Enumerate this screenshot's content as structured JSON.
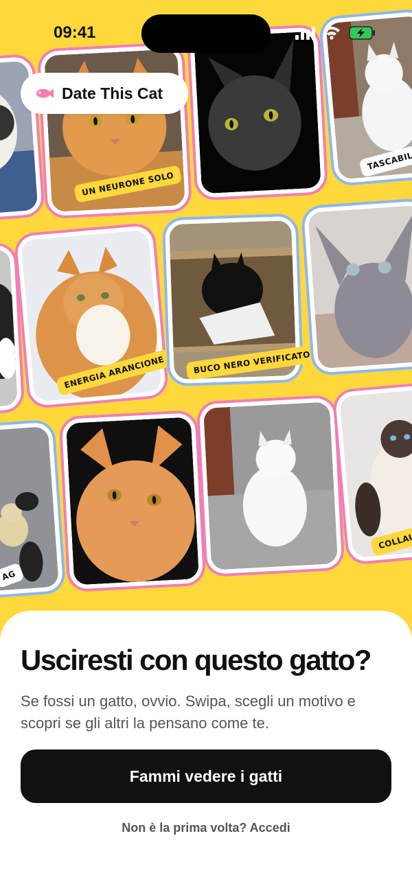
{
  "status_bar": {
    "time": "09:41"
  },
  "brand": {
    "name": "Date This Cat",
    "icon": "fish-icon"
  },
  "cards": [
    {
      "id": "c1",
      "tag": "",
      "photo": "calico-cat"
    },
    {
      "id": "c2",
      "tag": "UN NEURONE SOLO",
      "photo": "orange-tabby-cat"
    },
    {
      "id": "c3",
      "tag": "",
      "photo": "grey-cat"
    },
    {
      "id": "c4",
      "tag": "TASCABILE",
      "photo": "white-cat-small"
    },
    {
      "id": "c5",
      "tag": "",
      "photo": "tuxedo-cat"
    },
    {
      "id": "c6",
      "tag": "ENERGIA ARANCIONE",
      "photo": "fluffy-orange-cat"
    },
    {
      "id": "c7",
      "tag": "BUCO NERO VERIFICATO",
      "photo": "black-kitten-in-box"
    },
    {
      "id": "c8",
      "tag": "",
      "photo": "sphynx-cat"
    },
    {
      "id": "c9",
      "tag": "AG",
      "photo": "teddy-bear"
    },
    {
      "id": "c10",
      "tag": "",
      "photo": "orange-cat-closeup"
    },
    {
      "id": "c11",
      "tag": "",
      "photo": "white-cat-sitting"
    },
    {
      "id": "c12",
      "tag": "COLLAU",
      "photo": "siamese-cat"
    }
  ],
  "sheet": {
    "headline": "Usciresti con questo gatto?",
    "subtitle": "Se fossi un gatto, ovvio. Swipa, scegli un motivo e scopri se gli altri la pensano come te.",
    "cta_label": "Fammi vedere i gatti",
    "login_text": "Non è la prima volta? Accedi"
  },
  "colors": {
    "background": "#FFD83B",
    "pink_border": "#F07FB4",
    "blue_border": "#8DB7EE",
    "button": "#111111"
  }
}
